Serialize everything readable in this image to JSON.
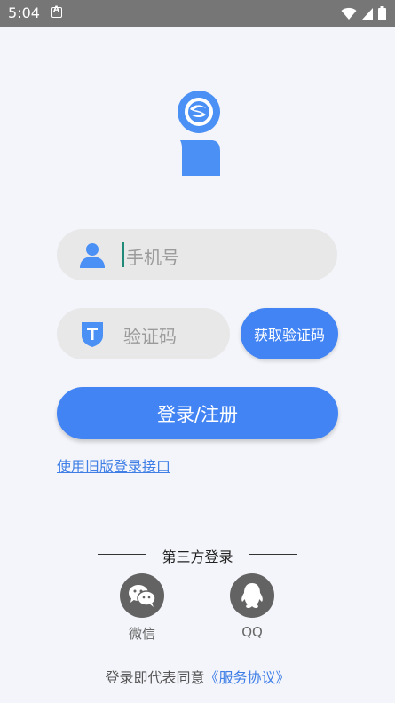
{
  "status_bar": {
    "time": "5:04"
  },
  "login": {
    "phone_placeholder": "手机号",
    "code_placeholder": "验证码",
    "get_code_label": "获取验证码",
    "submit_label": "登录/注册",
    "old_login_link": "使用旧版登录接口"
  },
  "third_party": {
    "title": "第三方登录",
    "providers": [
      {
        "label": "微信",
        "icon": "wechat-icon"
      },
      {
        "label": "QQ",
        "icon": "qq-icon"
      }
    ]
  },
  "agreement": {
    "prefix": "登录即代表同意",
    "link": "《服务协议》"
  },
  "colors": {
    "accent": "#4284f3",
    "link": "#3f7fe6",
    "background": "#f4f5fa",
    "input_bg": "#e8e8e8",
    "icon_blue": "#4a90f5"
  }
}
